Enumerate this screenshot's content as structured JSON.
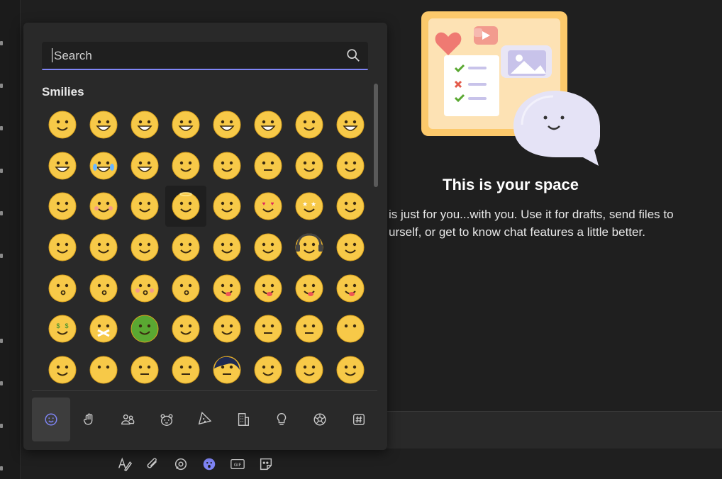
{
  "picker": {
    "search_placeholder": "Search",
    "section_title": "Smilies",
    "categories": [
      {
        "icon": "smiley-face-icon",
        "active": true
      },
      {
        "icon": "hand-wave-icon",
        "active": false
      },
      {
        "icon": "people-icon",
        "active": false
      },
      {
        "icon": "animal-bear-icon",
        "active": false
      },
      {
        "icon": "food-pizza-icon",
        "active": false
      },
      {
        "icon": "building-icon",
        "active": false
      },
      {
        "icon": "lightbulb-icon",
        "active": false
      },
      {
        "icon": "soccer-ball-icon",
        "active": false
      },
      {
        "icon": "hashtag-symbol-icon",
        "active": false
      }
    ],
    "emoji_rows": [
      [
        "smile",
        "big-smile",
        "laugh",
        "grin",
        "beaming",
        "xd-laugh",
        "sweat-smile",
        "rolling-laugh"
      ],
      [
        "winking-laugh",
        "tears-of-joy",
        "giggle",
        "slight-smile",
        "smile-2",
        "neutral-smile",
        "upside-down",
        "wink-smile"
      ],
      [
        "content",
        "blushing",
        "relieved",
        "halo",
        "love-hearts",
        "heart-eyes",
        "star-struck",
        "cool-thumb"
      ],
      [
        "wave",
        "hug",
        "hand-up",
        "point-up",
        "peace",
        "eye-roll-hand",
        "headphones",
        "cap-smile"
      ],
      [
        "kiss-heart",
        "kiss",
        "kiss-blush",
        "blow-kiss",
        "yum",
        "tongue",
        "tongue-out",
        "wink-tongue"
      ],
      [
        "money-mouth",
        "zipped",
        "sick",
        "thinking",
        "sleepy-clock",
        "neutral",
        "expressionless",
        "no-mouth"
      ],
      [
        "smirk",
        "awkward",
        "unamused",
        "sceptic",
        "emo",
        "eyes-up",
        "rolling-eyes",
        "grimace"
      ]
    ]
  },
  "welcome": {
    "title": "This is your space",
    "line1": " is just for you...with you. Use it for drafts, send files to",
    "line2": "urself, or get to know chat features a little better."
  },
  "compose_tools": [
    {
      "icon": "format-icon"
    },
    {
      "icon": "attach-icon"
    },
    {
      "icon": "loop-icon"
    },
    {
      "icon": "emoji-icon"
    },
    {
      "icon": "gif-icon"
    },
    {
      "icon": "sticker-icon"
    }
  ],
  "colors": {
    "accent": "#7f85f5",
    "emoji_yellow": "#f7c948",
    "sick_green": "#5aa832"
  }
}
